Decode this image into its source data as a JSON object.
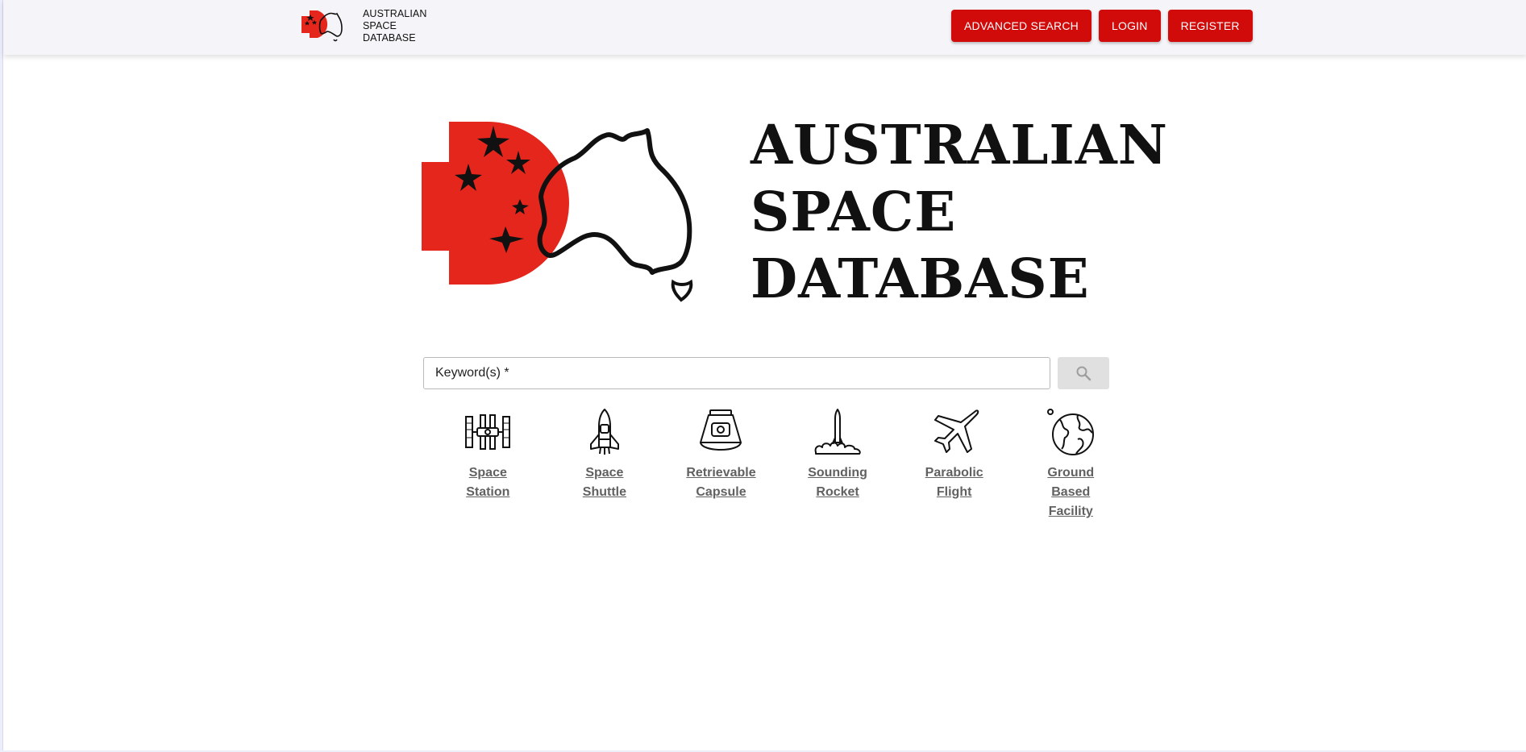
{
  "header": {
    "logo_text": [
      "AUSTRALIAN",
      "SPACE",
      "DATABASE"
    ],
    "buttons": {
      "advanced_search": "ADVANCED SEARCH",
      "login": "LOGIN",
      "register": "REGISTER"
    }
  },
  "hero": {
    "title_lines": [
      "AUSTRALIAN",
      "SPACE",
      "DATABASE"
    ]
  },
  "search": {
    "placeholder": "Keyword(s) *",
    "value": ""
  },
  "categories": [
    {
      "label_lines": [
        "Space",
        "Station"
      ],
      "icon": "space-station-icon"
    },
    {
      "label_lines": [
        "Space",
        "Shuttle"
      ],
      "icon": "space-shuttle-icon"
    },
    {
      "label_lines": [
        "Retrievable",
        "Capsule"
      ],
      "icon": "capsule-icon"
    },
    {
      "label_lines": [
        "Sounding",
        "Rocket"
      ],
      "icon": "rocket-icon"
    },
    {
      "label_lines": [
        "Parabolic",
        "Flight"
      ],
      "icon": "airplane-icon"
    },
    {
      "label_lines": [
        "Ground",
        "Based",
        "Facility"
      ],
      "icon": "globe-icon"
    }
  ],
  "colors": {
    "brand_red": "#d10a0a",
    "logo_red": "#e4261c",
    "header_bg": "#f5f4f8",
    "link_gray": "#616161"
  }
}
